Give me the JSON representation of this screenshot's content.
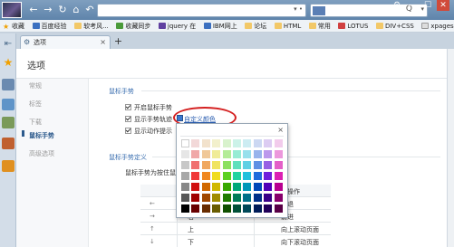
{
  "browser": {
    "window_controls": [
      "⚙",
      "—",
      "☐",
      "✕"
    ],
    "nav_glyphs": [
      "←",
      "→",
      "↻",
      "⌂",
      "↶"
    ],
    "address_dropdown": "▾ •",
    "search_dropdown": "▾",
    "search_glyph": "Q"
  },
  "bookmarks": [
    {
      "label": "收藏",
      "icon": "star-icon"
    },
    {
      "label": "百度经验",
      "icon": "baidu-icon"
    },
    {
      "label": "软考风...",
      "icon": "folder-icon"
    },
    {
      "label": "收藏同步",
      "icon": "sync-icon"
    },
    {
      "label": "jquery 在",
      "icon": "jquery-icon"
    },
    {
      "label": "IBM网上",
      "icon": "ibm-icon"
    },
    {
      "label": "论坛",
      "icon": "folder-icon"
    },
    {
      "label": "HTML",
      "icon": "folder-icon"
    },
    {
      "label": "常用",
      "icon": "folder-icon"
    },
    {
      "label": "LOTUS",
      "icon": "lotus-icon"
    },
    {
      "label": "DIV+CSS",
      "icon": "folder-icon"
    },
    {
      "label": "xpages",
      "icon": "page-icon"
    }
  ],
  "tab": {
    "label": "选项",
    "close": "×",
    "new": "+"
  },
  "page": {
    "title": "选项",
    "nav": [
      "常规",
      "标签",
      "下载",
      "鼠标手势",
      "高级选项"
    ],
    "gesture_section": "鼠标手势",
    "options": [
      "开启鼠标手势",
      "显示手势轨迹",
      "显示动作提示"
    ],
    "custom_color_link": "自定义颜色",
    "definition_section": "鼠标手势定义",
    "definition_desc": "鼠标手势为按住鼠",
    "table_header_right": "应操作",
    "rows": [
      {
        "gesture": "←",
        "name": "",
        "action": "后退"
      },
      {
        "gesture": "→",
        "name": "右",
        "action": "前进"
      },
      {
        "gesture": "↑",
        "name": "上",
        "action": "向上滚动页面"
      },
      {
        "gesture": "↓",
        "name": "下",
        "action": "向下滚动页面"
      }
    ]
  },
  "color_picker": {
    "close": "×",
    "palette": [
      [
        "#ffffff",
        "#f2d8d8",
        "#f2e2cc",
        "#f2f0cc",
        "#d8f2cc",
        "#ccf2e8",
        "#ccecf2",
        "#ccd8f2",
        "#dcccf2",
        "#f2ccec"
      ],
      [
        "#e6e6e6",
        "#f0a8a8",
        "#f0c898",
        "#f0ec98",
        "#b4ec98",
        "#98ecd4",
        "#98e0ec",
        "#98b4ec",
        "#bc98ec",
        "#ec98dc"
      ],
      [
        "#c8c8c8",
        "#f07070",
        "#f0a860",
        "#f0e460",
        "#8ce060",
        "#60e0bc",
        "#60d0e4",
        "#6090e4",
        "#9860e4",
        "#e460c8"
      ],
      [
        "#a8a8a8",
        "#f03838",
        "#f08820",
        "#f0dc20",
        "#5cd020",
        "#20d4a0",
        "#20c0dc",
        "#206cdc",
        "#7020dc",
        "#dc20b4"
      ],
      [
        "#888888",
        "#d01010",
        "#d06800",
        "#d0b800",
        "#38a800",
        "#00a878",
        "#0098b8",
        "#0048b8",
        "#5000b8",
        "#b80090"
      ],
      [
        "#585858",
        "#a00000",
        "#a04800",
        "#a08c00",
        "#207c00",
        "#007c58",
        "#007088",
        "#003088",
        "#380088",
        "#88006c"
      ],
      [
        "#000000",
        "#680000",
        "#682c00",
        "#685c00",
        "#105000",
        "#005038",
        "#004858",
        "#001c58",
        "#200058",
        "#580046"
      ]
    ]
  }
}
